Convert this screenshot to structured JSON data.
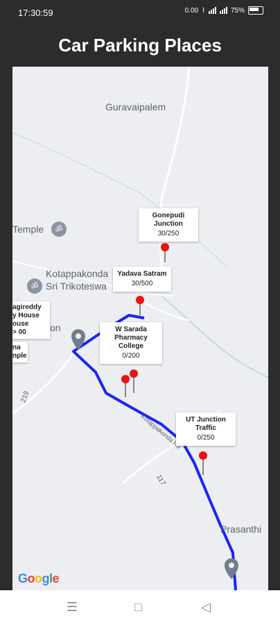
{
  "status": {
    "time": "17:30:59",
    "net_speed": "0.00",
    "battery_text": "75%"
  },
  "title": "Car Parking Places",
  "map": {
    "places": {
      "guravaipalem": "Guravaipalem",
      "temple": "Temple",
      "kotappakonda": "Kotappakonda",
      "sri_trikoteswa": "Sri Trikoteswa",
      "prasanthi": "Prasanthi",
      "on": "on"
    },
    "road_labels": {
      "r219": "219",
      "r117": "117",
      "kotappakonda_rd": "Kotappakonda Rd"
    },
    "parking": [
      {
        "name": "Gonepudi Junction",
        "count": "30/250"
      },
      {
        "name": "Yadava Satram",
        "count": "30/500"
      },
      {
        "name": "W Sarada Pharmacy College",
        "count": "0/200"
      },
      {
        "name": "UT Junction Traffic",
        "count": "0/250"
      }
    ],
    "partial_callout_lines": [
      "agireddy",
      "y",
      "House",
      "ouse",
      ">",
      "00",
      "na",
      "nple"
    ],
    "google_logo": "Google"
  },
  "nav": {
    "menu_icon": "menu-icon",
    "home_icon": "home-icon",
    "back_icon": "back-icon"
  }
}
